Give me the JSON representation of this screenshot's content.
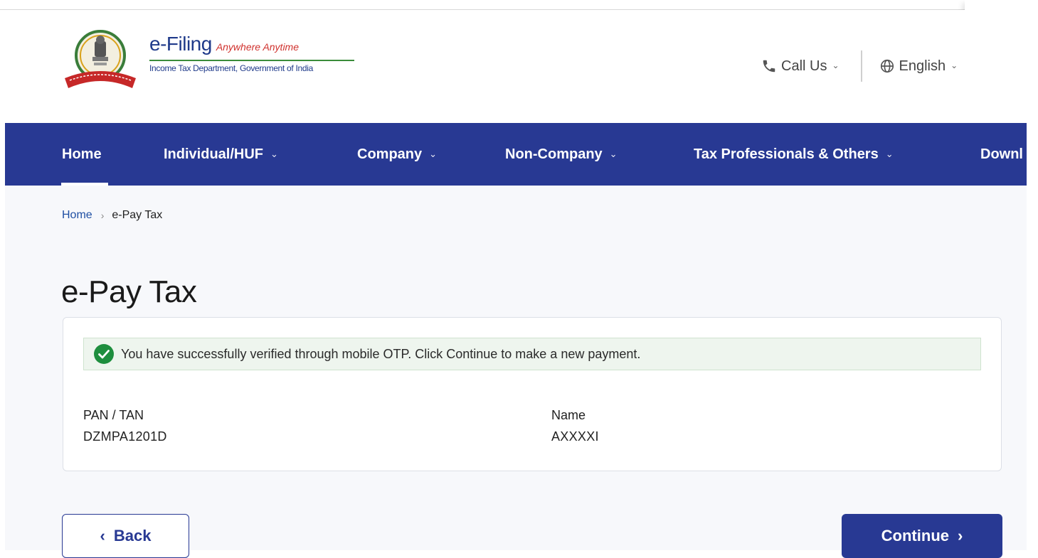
{
  "brand": {
    "title": "e-Filing",
    "tagline": "Anywhere Anytime",
    "subtitle": "Income Tax Department, Government of India",
    "emblem_icon": "national-emblem-icon"
  },
  "header": {
    "call_us_label": "Call Us",
    "call_icon": "phone-icon",
    "language_label": "English",
    "language_icon": "globe-icon"
  },
  "nav": {
    "items": [
      {
        "label": "Home",
        "active": true,
        "has_dropdown": false
      },
      {
        "label": "Individual/HUF",
        "has_dropdown": true
      },
      {
        "label": "Company",
        "has_dropdown": true
      },
      {
        "label": "Non-Company",
        "has_dropdown": true
      },
      {
        "label": "Tax Professionals & Others",
        "has_dropdown": true
      },
      {
        "label": "Downl",
        "has_dropdown": false
      }
    ],
    "chevron": "⌄"
  },
  "breadcrumb": {
    "home": "Home",
    "separator": "›",
    "current": "e-Pay Tax"
  },
  "page": {
    "title": "e-Pay Tax"
  },
  "alert": {
    "icon": "check-circle-icon",
    "message": "You have successfully verified through mobile OTP. Click Continue to make a new payment."
  },
  "details": {
    "pan_label": "PAN / TAN",
    "pan_value": "DZMPA1201D",
    "name_label": "Name",
    "name_value": "AXXXXI"
  },
  "actions": {
    "back_label": "Back",
    "back_chevron": "‹",
    "continue_label": "Continue",
    "continue_chevron": "›"
  },
  "colors": {
    "nav_bg": "#283993",
    "link": "#1f4fa3",
    "success": "#1e8e3e",
    "alert_bg": "#eef5ee"
  }
}
